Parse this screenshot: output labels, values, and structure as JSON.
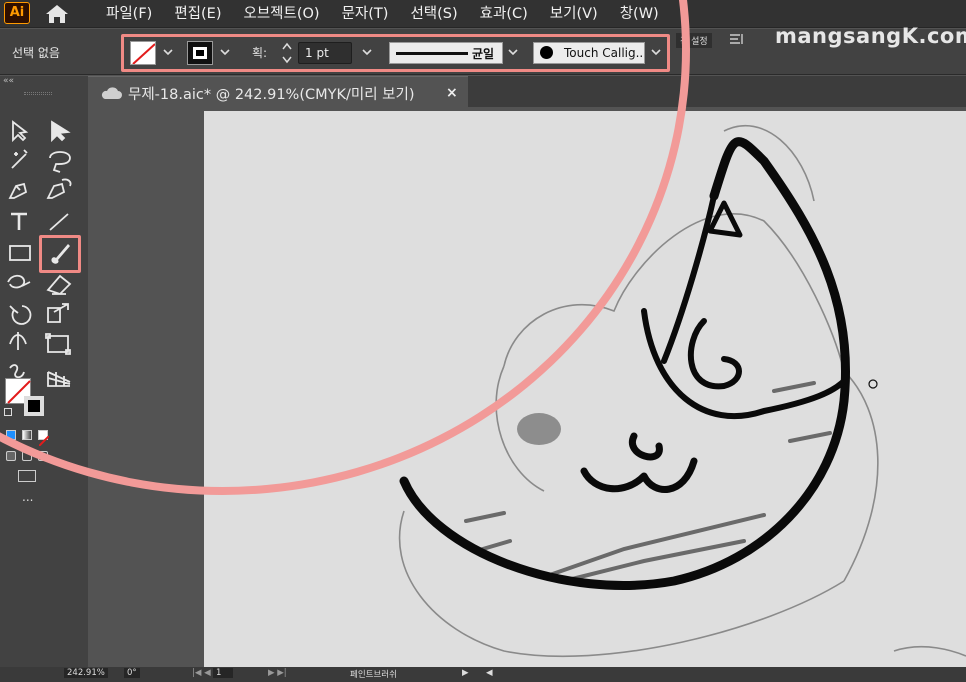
{
  "app": {
    "logo": "Ai",
    "icons": {
      "home": "home-icon",
      "cloud": "cloud-icon"
    }
  },
  "menu": [
    "파일(F)",
    "편집(E)",
    "오브젝트(O)",
    "문자(T)",
    "선택(S)",
    "효과(C)",
    "보기(V)",
    "창(W)"
  ],
  "control_bar": {
    "selection_label": "선택 없음",
    "stroke_weight_label": "획:",
    "stroke_weight_value": "1 pt",
    "profile_label": "균일",
    "brush_name": "Touch Callig...",
    "right_partial": "경 설정"
  },
  "watermark": "mangsangK.com",
  "document_tab": {
    "title": "무제-18.aic* @ 242.91%(CMYK/미리 보기)",
    "close": "×"
  },
  "toolbar": {
    "collapse": "««",
    "tools": [
      "selection-tool",
      "direct-selection-tool",
      "magic-wand-tool",
      "lasso-tool",
      "pen-tool",
      "curvature-tool",
      "type-tool",
      "line-tool",
      "rectangle-tool",
      "paintbrush-tool",
      "shaper-tool",
      "eraser-tool",
      "rotate-tool",
      "scale-tool",
      "warp-tool",
      "free-transform-tool",
      "shape-builder-tool",
      "perspective-grid-tool"
    ],
    "more": "..."
  },
  "status_bar": {
    "zoom": "242.91%",
    "rotation": "0°",
    "page": "1",
    "tool_label": "페인트브러쉬"
  },
  "colors": {
    "highlight": "#f08a85",
    "ring": "#f29a98",
    "accent_ai": "#ff9a00"
  }
}
